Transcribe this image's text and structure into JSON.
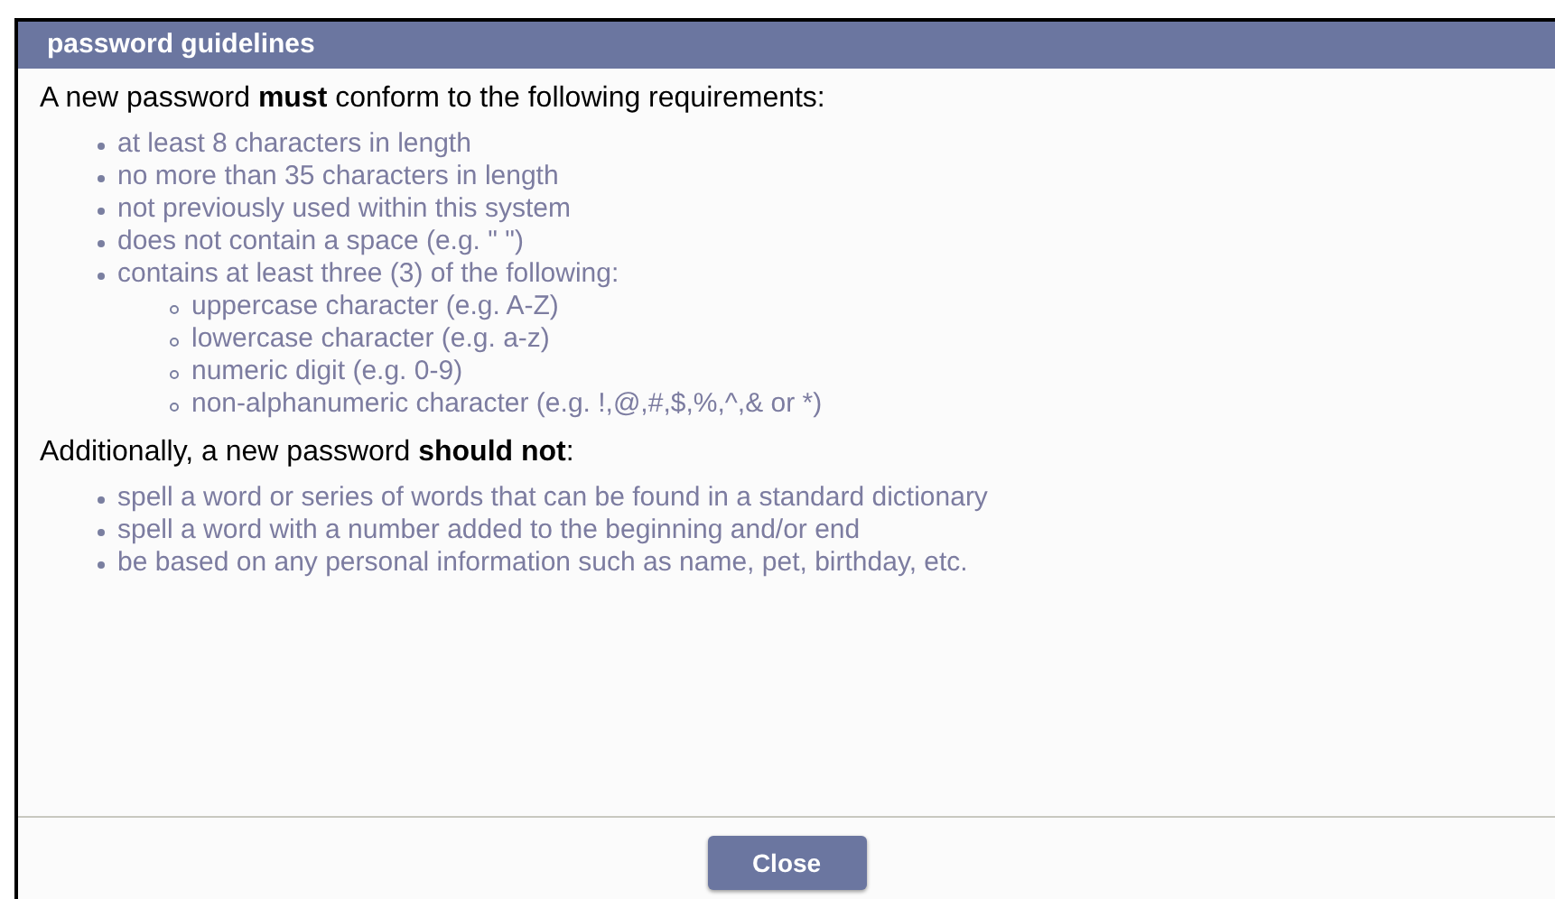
{
  "dialog": {
    "title": "password guidelines",
    "sections": [
      {
        "intro": "A new password **must** conform to the following requirements:",
        "items": [
          {
            "text": "at least 8 characters in length"
          },
          {
            "text": "no more than 35 characters in length"
          },
          {
            "text": "not previously used within this system"
          },
          {
            "text": "does not contain a space (e.g. \" \")"
          },
          {
            "text": "contains at least three (3) of the following:",
            "children": [
              {
                "text": "uppercase character (e.g. A-Z)"
              },
              {
                "text": "lowercase character (e.g. a-z)"
              },
              {
                "text": "numeric digit (e.g. 0-9)"
              },
              {
                "text": "non-alphanumeric character (e.g. !,@,#,$,%,^,& or *)"
              }
            ]
          }
        ]
      },
      {
        "intro": "Additionally, a new password **should not**:",
        "items": [
          {
            "text": "spell a word or series of words that can be found in a standard dictionary"
          },
          {
            "text": "spell a word with a number added to the beginning and/or end"
          },
          {
            "text": "be based on any personal information such as name, pet, birthday, etc."
          }
        ]
      }
    ],
    "buttons": [
      "Close"
    ]
  }
}
